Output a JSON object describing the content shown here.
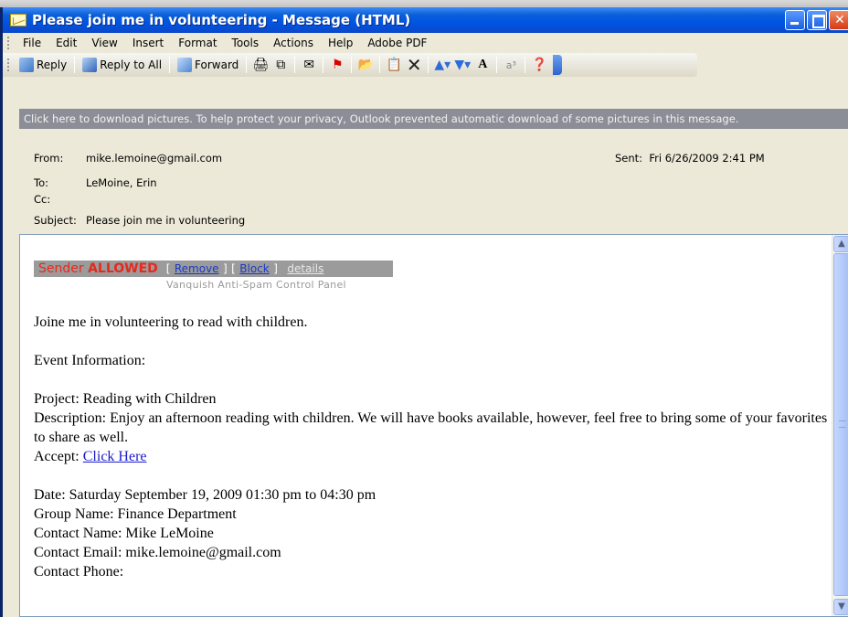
{
  "window": {
    "title": "Please join me in volunteering - Message (HTML)"
  },
  "menu": [
    {
      "label": "File"
    },
    {
      "label": "Edit"
    },
    {
      "label": "View"
    },
    {
      "label": "Insert"
    },
    {
      "label": "Format"
    },
    {
      "label": "Tools"
    },
    {
      "label": "Actions"
    },
    {
      "label": "Help"
    },
    {
      "label": "Adobe PDF"
    }
  ],
  "toolbar": {
    "reply": "Reply",
    "reply_all": "Reply to All",
    "forward": "Forward"
  },
  "infobar": {
    "text": "Click here to download pictures. To help protect your privacy, Outlook prevented automatic download of some pictures in this message."
  },
  "header": {
    "from_label": "From:",
    "from": "mike.lemoine@gmail.com",
    "to_label": "To:",
    "to": "LeMoine, Erin",
    "cc_label": "Cc:",
    "cc": "",
    "subject_label": "Subject:",
    "subject": "Please join me in volunteering",
    "sent_label": "Sent:",
    "sent": "Fri 6/26/2009 2:41 PM"
  },
  "spam_panel": {
    "sender": "Sender",
    "status": "ALLOWED",
    "open_bracket_1": "[",
    "remove": "Remove",
    "close_bracket_1": "]",
    "open_bracket_2": "[",
    "block": "Block",
    "close_bracket_2": "]",
    "details": "details",
    "caption": "Vanquish Anti-Spam Control Panel"
  },
  "message": {
    "intro": "Joine me in volunteering to read with children.",
    "event_heading": "Event Information:",
    "project": "Project: Reading with Children",
    "description": "Description: Enjoy an afternoon reading with children. We will have books available, however, feel free to bring some of your favorites to share as well.",
    "accept_label": "Accept: ",
    "accept_link": "Click Here",
    "date": "Date: Saturday September 19, 2009 01:30 pm to 04:30 pm",
    "group": "Group Name: Finance Department",
    "contact_name": "Contact Name: Mike LeMoine",
    "contact_email": "Contact Email: mike.lemoine@gmail.com",
    "contact_phone": "Contact Phone:"
  }
}
